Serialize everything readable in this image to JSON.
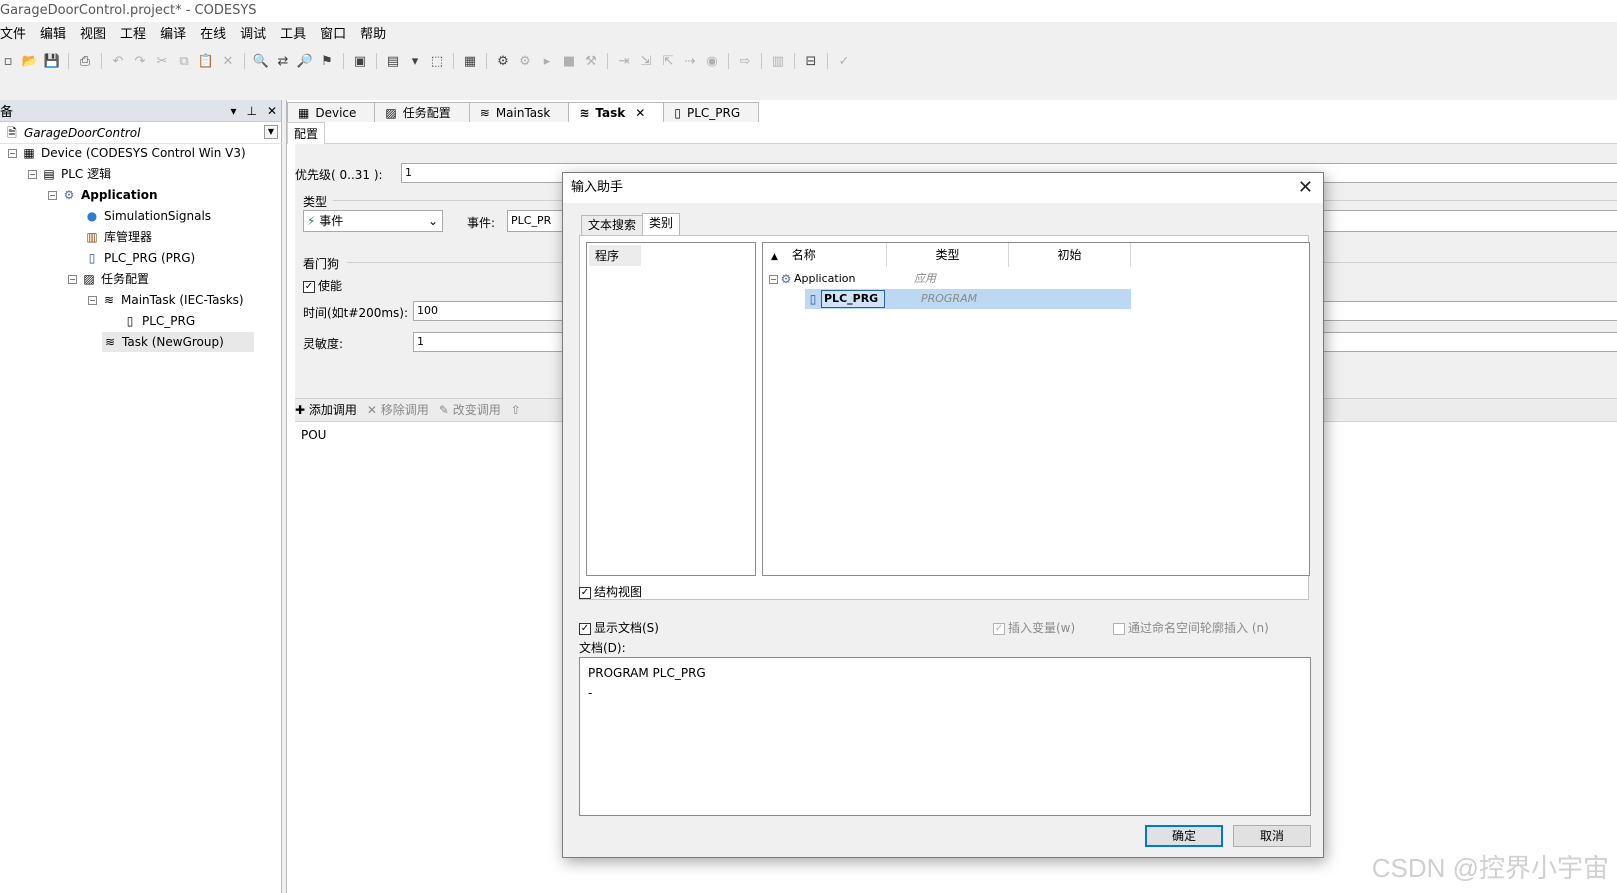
{
  "window": {
    "title": "GarageDoorControl.project* - CODESYS"
  },
  "menu": [
    "文件",
    "编辑",
    "视图",
    "工程",
    "编译",
    "在线",
    "调试",
    "工具",
    "窗口",
    "帮助"
  ],
  "left_panel": {
    "title": "备",
    "tree": [
      {
        "label": "GarageDoorControl",
        "icon": "project-icon"
      },
      {
        "label": "Device (CODESYS Control Win V3)",
        "icon": "device-icon"
      },
      {
        "label": "PLC 逻辑",
        "icon": "plc-logic-icon"
      },
      {
        "label": "Application",
        "icon": "gear-icon"
      },
      {
        "label": "SimulationSignals",
        "icon": "globe-icon"
      },
      {
        "label": "库管理器",
        "icon": "library-icon"
      },
      {
        "label": "PLC_PRG (PRG)",
        "icon": "pou-icon"
      },
      {
        "label": "任务配置",
        "icon": "task-config-icon"
      },
      {
        "label": "MainTask (IEC-Tasks)",
        "icon": "task-icon"
      },
      {
        "label": "PLC_PRG",
        "icon": "pou-call-icon"
      },
      {
        "label": "Task (NewGroup)",
        "icon": "task-icon"
      }
    ]
  },
  "editor": {
    "tabs": [
      "Device",
      "任务配置",
      "MainTask",
      "Task",
      "PLC_PRG"
    ],
    "subtab": "配置",
    "priority_label": "优先级( 0..31 ):",
    "priority_value": "1",
    "type_label": "类型",
    "type_value": "事件",
    "event_label": "事件:",
    "event_value": "PLC_PR",
    "watchdog_label": "看门狗",
    "enable_label": "使能",
    "time_label": "时间(如t#200ms):",
    "time_value": "100",
    "sensitivity_label": "灵敏度:",
    "sensitivity_value": "1",
    "call_toolbar": {
      "add": "添加调用",
      "remove": "移除调用",
      "change": "改变调用"
    },
    "pou_header": "POU"
  },
  "dialog": {
    "title": "输入助手",
    "tabs": [
      "文本搜索",
      "类别"
    ],
    "categories": [
      "程序"
    ],
    "columns": [
      "名称",
      "类型",
      "初始"
    ],
    "rows": [
      {
        "name": "Application",
        "type": "应用"
      },
      {
        "name": "PLC_PRG",
        "type": "PROGRAM"
      }
    ],
    "structured_view": "结构视图",
    "show_doc": "显示文档(S)",
    "insert_var": "插入变量(w)",
    "namespace_insert": "通过命名空间轮廓插入 (n)",
    "doc_label": "文档(D):",
    "doc_lines": [
      "PROGRAM PLC_PRG",
      "-"
    ],
    "ok": "确定",
    "cancel": "取消"
  },
  "watermark": "CSDN @控界小宇宙"
}
